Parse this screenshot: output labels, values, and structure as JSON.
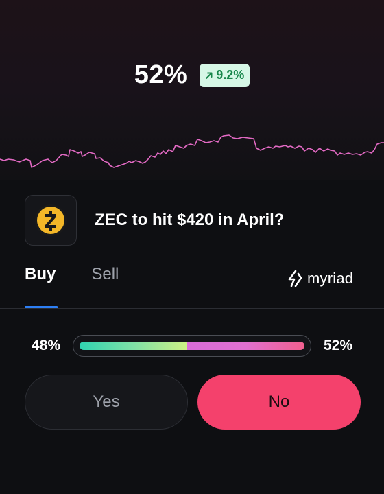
{
  "market": {
    "probability": "52%",
    "change": "9.2%",
    "change_direction": "up",
    "title": "ZEC to hit $420 in April?",
    "coin_icon": "zcash-icon",
    "price_line_color": "#e36ac4"
  },
  "tabs": [
    {
      "label": "Buy",
      "active": true
    },
    {
      "label": "Sell",
      "active": false
    }
  ],
  "brand": {
    "name": "myriad",
    "icon": "myriad-logo-icon"
  },
  "odds": {
    "yes_percent": "48%",
    "no_percent": "52%",
    "yes_fraction": 0.48,
    "no_fraction": 0.52
  },
  "buttons": {
    "yes_label": "Yes",
    "no_label": "No"
  },
  "colors": {
    "accent_blue": "#2d7ff4",
    "no_button": "#f4416c",
    "change_badge_bg": "#d6f7e6",
    "change_badge_text": "#17864a"
  }
}
